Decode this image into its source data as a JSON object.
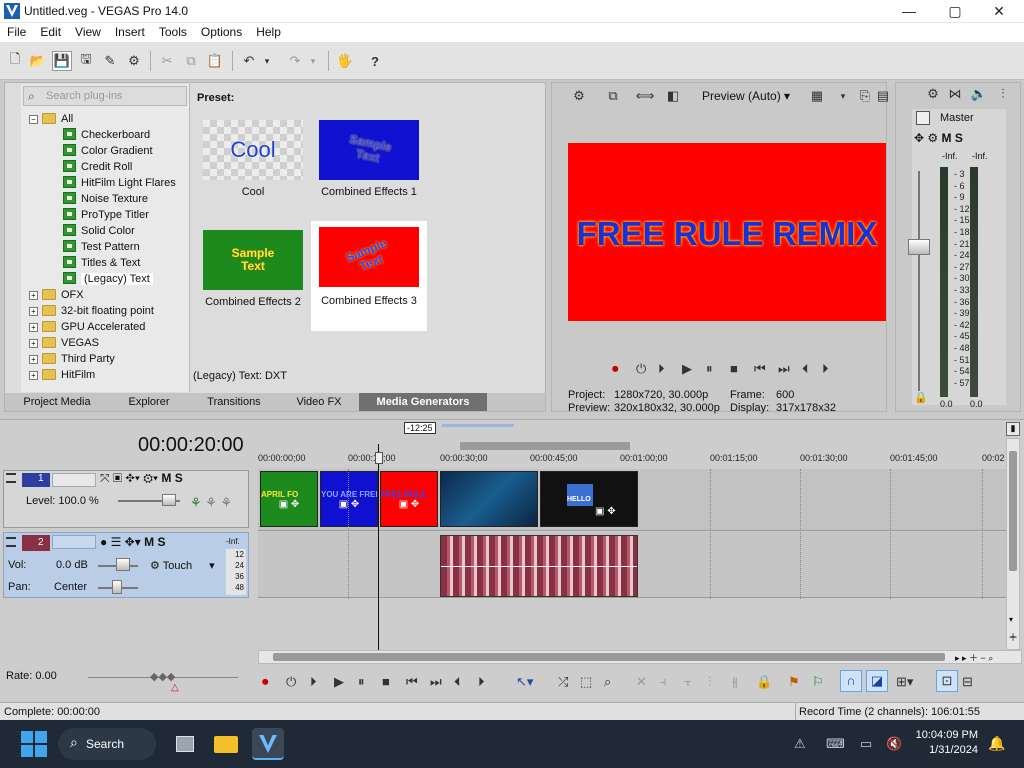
{
  "window": {
    "title": "Untitled.veg - VEGAS Pro 14.0"
  },
  "menu": [
    "File",
    "Edit",
    "View",
    "Insert",
    "Tools",
    "Options",
    "Help"
  ],
  "explorer": {
    "search_placeholder": "Search plug-ins",
    "tree": [
      {
        "label": "All",
        "type": "folder",
        "expanded": true
      },
      {
        "label": "Checkerboard",
        "type": "plugin"
      },
      {
        "label": "Color Gradient",
        "type": "plugin"
      },
      {
        "label": "Credit Roll",
        "type": "plugin"
      },
      {
        "label": "HitFilm Light Flares",
        "type": "plugin"
      },
      {
        "label": "Noise Texture",
        "type": "plugin"
      },
      {
        "label": "ProType Titler",
        "type": "plugin"
      },
      {
        "label": "Solid Color",
        "type": "plugin"
      },
      {
        "label": "Test Pattern",
        "type": "plugin"
      },
      {
        "label": "Titles & Text",
        "type": "plugin"
      },
      {
        "label": "(Legacy) Text",
        "type": "plugin",
        "selected": true
      },
      {
        "label": "OFX",
        "type": "folder"
      },
      {
        "label": "32-bit floating point",
        "type": "folder"
      },
      {
        "label": "GPU Accelerated",
        "type": "folder"
      },
      {
        "label": "VEGAS",
        "type": "folder"
      },
      {
        "label": "Third Party",
        "type": "folder"
      },
      {
        "label": "HitFilm",
        "type": "folder"
      }
    ],
    "preset_label": "Preset:",
    "presets": [
      {
        "label": "Cool",
        "thumb_text": "Cool"
      },
      {
        "label": "Combined Effects 1",
        "thumb_text": "Sample Text"
      },
      {
        "label": "Combined Effects 2",
        "thumb_text": "Sample Text"
      },
      {
        "label": "Combined Effects 3",
        "thumb_text": "Sample Text",
        "selected": true
      }
    ],
    "status": "(Legacy) Text: DXT",
    "tabs": [
      "Project Media",
      "Explorer",
      "Transitions",
      "Video FX",
      "Media Generators"
    ],
    "active_tab": "Media Generators"
  },
  "preview": {
    "mode": "Preview (Auto)",
    "screen_text": "FREE RULE REMIX",
    "project_label": "Project:",
    "project_value": "1280x720, 30.000p",
    "frame_label": "Frame:",
    "frame_value": "600",
    "preview_label": "Preview:",
    "preview_value": "320x180x32, 30.000p",
    "display_label": "Display:",
    "display_value": "317x178x32"
  },
  "mixer": {
    "title": "Master",
    "meter_top": "-Inf.",
    "scale": [
      "3",
      "6",
      "9",
      "12",
      "15",
      "18",
      "21",
      "24",
      "27",
      "30",
      "33",
      "36",
      "39",
      "42",
      "45",
      "48",
      "51",
      "54",
      "57"
    ],
    "left_value": "0.0",
    "right_value": "0.0"
  },
  "timeline": {
    "timecode": "00:00:20:00",
    "marker": "-12:25",
    "ruler": [
      "00:00:00;00",
      "00:00:15;00",
      "00:00:30;00",
      "00:00:45;00",
      "00:01:00;00",
      "00:01:15;00",
      "00:01:30;00",
      "00:01:45;00",
      "00:02"
    ],
    "track1": {
      "number": "1",
      "level_label": "Level: 100.0 %"
    },
    "track2": {
      "number": "2",
      "vol_label": "Vol:",
      "vol_value": "0.0 dB",
      "pan_label": "Pan:",
      "pan_value": "Center",
      "mode": "Touch",
      "meter_top": "-Inf.",
      "meter_scale": [
        "12",
        "24",
        "36",
        "48"
      ]
    },
    "clip_texts": [
      "APRIL FO",
      "YOU ARE FREE",
      "FREE RULE",
      "HELLO"
    ],
    "rate": "Rate: 0.00",
    "status_left": "Complete: 00:00:00",
    "status_right": "Record Time (2 channels): 106:01:55"
  },
  "taskbar": {
    "search": "Search",
    "time": "10:04:09 PM",
    "date": "1/31/2024"
  },
  "colors": {
    "vegas_red": "#ff0000",
    "text_blue": "#1b2fd8",
    "clip_green": "#1c8a1c",
    "clip_blue": "#1010d0",
    "audio": "#8a3044",
    "taskbar": "#1f2a36"
  }
}
